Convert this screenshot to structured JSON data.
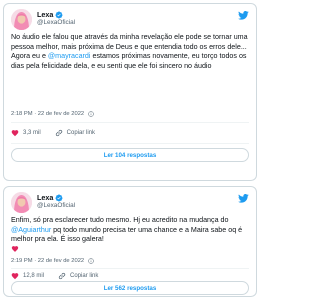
{
  "tweets": [
    {
      "author": "Lexa",
      "handle": "@LexaOficial",
      "text_parts": [
        {
          "t": "No áudio ele falou que através da minha revelação ele pode se tornar uma pessoa melhor, mais próxima de Deus e que entendia todo os erros dele... Agora eu e "
        },
        {
          "t": "@mayracardi",
          "mention": true
        },
        {
          "t": " estamos próximas novamente, eu torço todos os dias pela felicidade dela, e eu senti que ele foi sincero no áudio"
        }
      ],
      "timestamp": "2:18 PM · 22 de fev de 2022",
      "likes": "3,3 mil",
      "copy_link": "Copiar link",
      "replies_label": "Ler 104 respostas"
    },
    {
      "author": "Lexa",
      "handle": "@LexaOficial",
      "text_parts": [
        {
          "t": "Enfim, só pra esclarecer tudo mesmo. Hj eu acredito na mudança do "
        },
        {
          "t": "@Aguiarthur",
          "mention": true
        },
        {
          "t": " pq todo mundo precisa ter uma chance e a Maira sabe oq é melhor pra ela. É isso galera! "
        }
      ],
      "timestamp": "2:19 PM · 22 de fev de 2022",
      "likes": "12,8 mil",
      "copy_link": "Copiar link",
      "replies_label": "Ler 562 respostas"
    }
  ],
  "colors": {
    "accent": "#1d9bf0",
    "heart": "#e0245e",
    "muted": "#536471"
  },
  "icons": [
    "avatar",
    "verified-badge-icon",
    "twitter-bird-icon",
    "info-icon",
    "heart-icon",
    "link-icon",
    "red-heart-emoji-icon"
  ]
}
